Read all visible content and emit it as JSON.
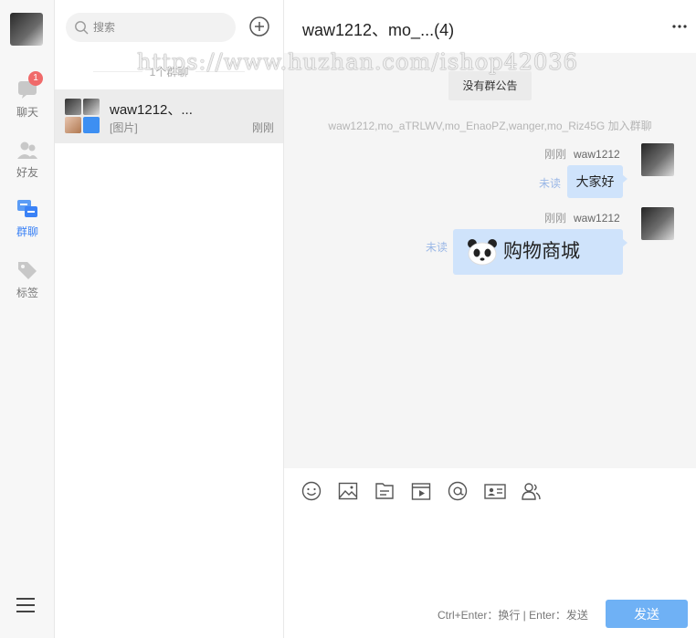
{
  "rail": {
    "items": [
      {
        "label": "聊天",
        "badge": "1",
        "icon": "chat-bubble-icon"
      },
      {
        "label": "好友",
        "icon": "friends-icon"
      },
      {
        "label": "群聊",
        "icon": "group-chat-icon",
        "active": true
      },
      {
        "label": "标签",
        "icon": "tag-icon"
      }
    ],
    "menu_icon": "hamburger-menu-icon"
  },
  "list": {
    "search_placeholder": "搜索",
    "group_count": "1个群聊",
    "conversations": [
      {
        "name": "waw1212、...",
        "preview": "[图片]",
        "time": "刚刚"
      }
    ]
  },
  "chat": {
    "title": "waw1212、mo_...(4)",
    "notice": "没有群公告",
    "system_message": "waw1212,mo_aTRLWV,mo_EnaoPZ,wanger,mo_Riz45G 加入群聊",
    "messages": [
      {
        "time": "刚刚",
        "sender": "waw1212",
        "status": "未读",
        "text": "大家好"
      },
      {
        "time": "刚刚",
        "sender": "waw1212",
        "status": "未读",
        "text": "购物商城"
      }
    ]
  },
  "compose": {
    "tools": [
      "emoji-icon",
      "image-icon",
      "file-icon",
      "video-icon",
      "at-icon",
      "card-icon",
      "contact-icon"
    ],
    "hint": "Ctrl+Enter：换行 | Enter：发送",
    "send_label": "发送"
  },
  "watermark": "https://www.huzhan.com/ishop42036",
  "colors": {
    "accent": "#3b82f6",
    "bubble": "#cfe3fb",
    "send": "#6fb1f5",
    "badge": "#f06a6a"
  }
}
